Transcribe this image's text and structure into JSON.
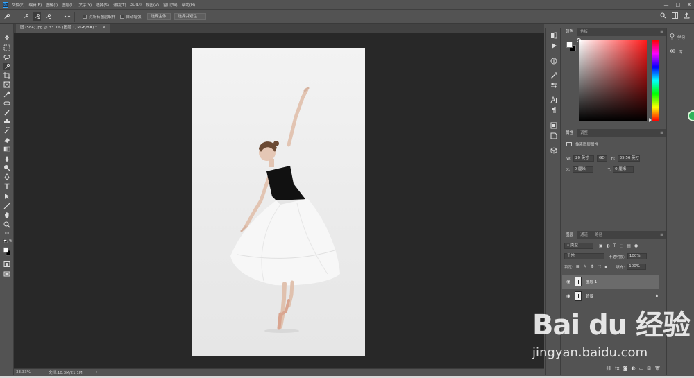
{
  "app": {
    "logo": "Ps"
  },
  "menubar": {
    "items": [
      "文件(F)",
      "编辑(E)",
      "图像(I)",
      "图层(L)",
      "文字(Y)",
      "选择(S)",
      "滤镜(T)",
      "3D(D)",
      "视图(V)",
      "窗口(W)",
      "帮助(H)"
    ],
    "controls": {
      "minimize": "—",
      "maximize": "□",
      "close": "✕"
    }
  },
  "options_bar": {
    "sample_all_layers": "对所有图层取样",
    "auto_enhance": "自动增强",
    "select_subject": "选择主体",
    "select_and_mask": "选择并遮住 ..."
  },
  "document": {
    "tab_title": "图 (584).jpg @ 33.3% (图层 1, RGB/8#) *",
    "tab_close": "×",
    "zoom": "33.33%",
    "doc_info": "文档:10.3M/21.1M",
    "status_arrow": "›"
  },
  "color_panel": {
    "tabs": [
      "颜色",
      "色板"
    ],
    "foreground": "#ffffff",
    "background": "#000000"
  },
  "properties_panel": {
    "tabs": [
      "属性",
      "调整"
    ],
    "section_title": "像素图层属性",
    "w_label": "W:",
    "w_value": "20 英寸",
    "link_icon": "GO",
    "h_label": "H:",
    "h_value": "35.56 英寸",
    "x_label": "X:",
    "x_value": "0 厘米",
    "y_label": "Y:",
    "y_value": "0 厘米"
  },
  "layers_panel": {
    "tabs": [
      "图层",
      "通道",
      "路径"
    ],
    "filter_kind": "类型",
    "blend_mode": "正常",
    "opacity_label": "不透明度:",
    "opacity_value": "100%",
    "lock_label": "锁定:",
    "fill_label": "填充:",
    "fill_value": "100%",
    "layers": [
      {
        "name": "图层 1",
        "selected": true
      },
      {
        "name": "背景",
        "selected": false
      }
    ]
  },
  "right_panel": {
    "learn": "学习",
    "libraries": "库"
  },
  "watermark": {
    "logo": "Bai du 经验",
    "url": "jingyan.baidu.com"
  }
}
